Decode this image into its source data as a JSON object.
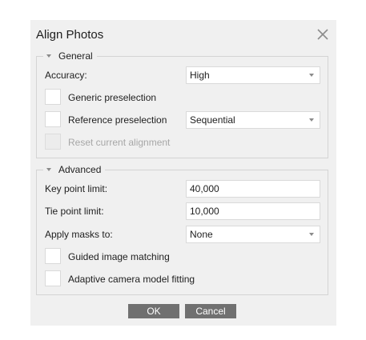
{
  "dialog": {
    "title": "Align Photos",
    "close_icon": "close-icon"
  },
  "general": {
    "header": "General",
    "accuracy_label": "Accuracy:",
    "accuracy_value": "High",
    "generic_preselection_label": "Generic preselection",
    "generic_preselection_checked": false,
    "reference_preselection_label": "Reference preselection",
    "reference_preselection_checked": false,
    "reference_preselection_value": "Sequential",
    "reset_alignment_label": "Reset current alignment",
    "reset_alignment_checked": false
  },
  "advanced": {
    "header": "Advanced",
    "key_point_limit_label": "Key point limit:",
    "key_point_limit_value": "40,000",
    "tie_point_limit_label": "Tie point limit:",
    "tie_point_limit_value": "10,000",
    "apply_masks_label": "Apply masks to:",
    "apply_masks_value": "None",
    "guided_matching_label": "Guided image matching",
    "guided_matching_checked": false,
    "adaptive_fitting_label": "Adaptive camera model fitting",
    "adaptive_fitting_checked": false
  },
  "buttons": {
    "ok_label": "OK",
    "cancel_label": "Cancel"
  },
  "colors": {
    "dialog_bg": "#f0f0f0",
    "button_bg": "#707070",
    "border": "#d4d4d4"
  }
}
